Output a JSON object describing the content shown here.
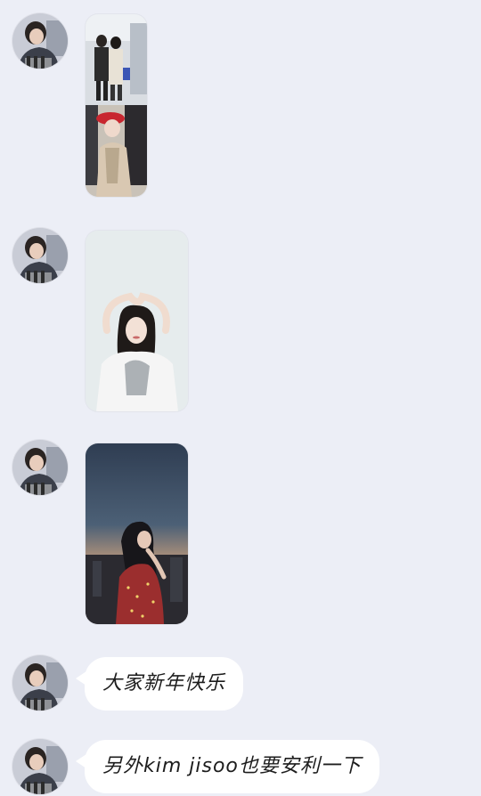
{
  "chat": {
    "messages": [
      {
        "type": "image",
        "description_icon": "photo-collage-icon"
      },
      {
        "type": "image",
        "description_icon": "photo-icon"
      },
      {
        "type": "image",
        "description_icon": "photo-icon"
      },
      {
        "type": "text",
        "text": "大家新年快乐"
      },
      {
        "type": "text",
        "text": "另外kim jisoo也要安利一下"
      }
    ]
  },
  "colors": {
    "background": "#eceef6",
    "bubble": "#ffffff",
    "text": "#1d1d1d"
  }
}
